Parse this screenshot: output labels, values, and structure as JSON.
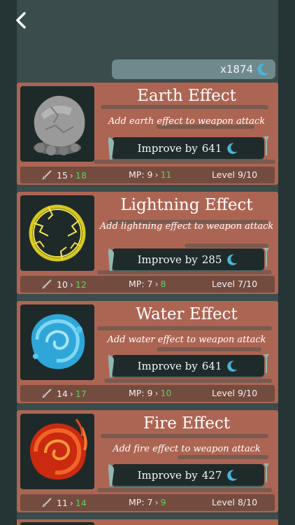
{
  "header": {
    "back_icon": "chevron-left-icon",
    "currency_amount": "x1874",
    "currency_icon": "crescent-moon-icon"
  },
  "colors": {
    "card": "#ad6553",
    "stats_bar": "#744b3f",
    "button": "#1f2b2b",
    "currency_bar": "#6f8a8d",
    "accent_moon": "#49b6d6",
    "increase_green": "#5fd05f"
  },
  "effects": [
    {
      "title": "Earth Effect",
      "description": "Add earth effect to weapon attack",
      "improve_label": "Improve by",
      "improve_cost": "641",
      "atk_current": "15",
      "atk_next": "18",
      "mp_label": "MP:",
      "mp_current": "9",
      "mp_next": "11",
      "level": "Level 9/10",
      "icon": "boulder-icon"
    },
    {
      "title": "Lightning Effect",
      "description": "Add lightning effect to weapon attack",
      "improve_label": "Improve by",
      "improve_cost": "285",
      "atk_current": "10",
      "atk_next": "12",
      "mp_label": "MP:",
      "mp_current": "7",
      "mp_next": "8",
      "level": "Level 7/10",
      "icon": "lightning-ring-icon"
    },
    {
      "title": "Water Effect",
      "description": "Add water effect to weapon attack",
      "improve_label": "Improve by",
      "improve_cost": "641",
      "atk_current": "14",
      "atk_next": "17",
      "mp_label": "MP:",
      "mp_current": "9",
      "mp_next": "10",
      "level": "Level 9/10",
      "icon": "water-swirl-icon"
    },
    {
      "title": "Fire Effect",
      "description": "Add fire effect to weapon attack",
      "improve_label": "Improve by",
      "improve_cost": "427",
      "atk_current": "11",
      "atk_next": "14",
      "mp_label": "MP:",
      "mp_current": "7",
      "mp_next": "9",
      "level": "Level 8/10",
      "icon": "fire-swirl-icon"
    }
  ]
}
